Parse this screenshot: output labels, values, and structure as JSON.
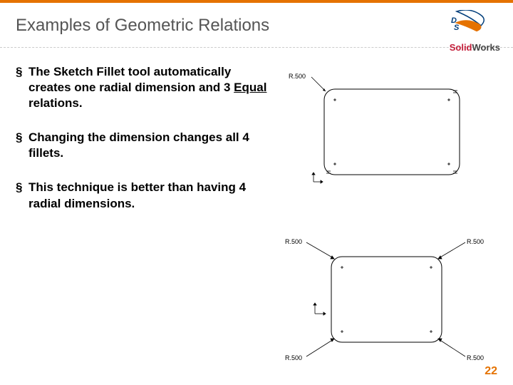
{
  "slide": {
    "title": "Examples of Geometric Relations",
    "page_number": "22"
  },
  "logo": {
    "prefix": "Solid",
    "suffix": "Works"
  },
  "bullets": [
    {
      "pre": "The Sketch Fillet tool automatically creates one radial dimension and 3 ",
      "underline": "Equal",
      "post": " relations."
    },
    {
      "pre": "Changing the dimension changes all 4 fillets.",
      "underline": "",
      "post": ""
    },
    {
      "pre": "This technique is better than having 4 radial dimensions.",
      "underline": "",
      "post": ""
    }
  ],
  "figures": {
    "top": {
      "r_label": "R.500",
      "corner_markers": [
        "=",
        "=",
        "=",
        "="
      ]
    },
    "bottom": {
      "labels": {
        "tl": "R.500",
        "tr": "R.500",
        "bl": "R.500",
        "br": "R.500"
      }
    }
  }
}
